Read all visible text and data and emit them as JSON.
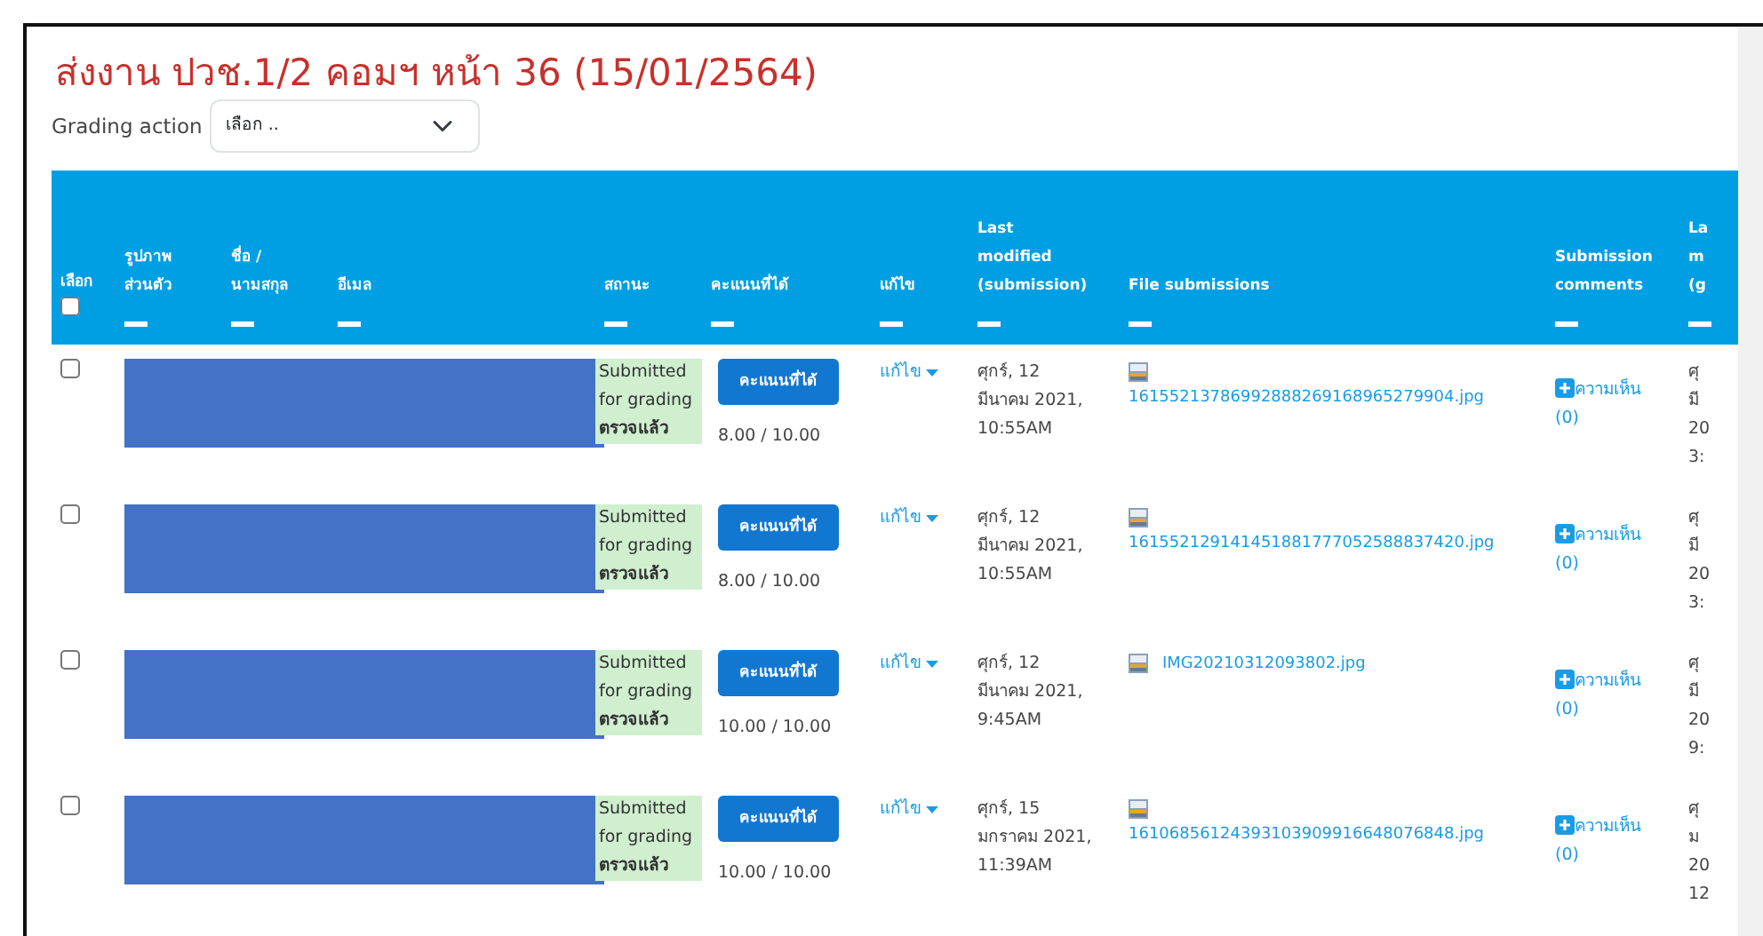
{
  "title": "ส่งงาน ปวช.1/2 คอมฯ หน้า 36 (15/01/2564)",
  "grading_action": {
    "label": "Grading action",
    "value": "เลือก .."
  },
  "table": {
    "select_all": {
      "label": "เลือก",
      "checked": false
    },
    "columns": [
      {
        "lines": [
          "รูปภาพ",
          "ส่วนตัว"
        ]
      },
      {
        "lines": [
          "ชื่อ /",
          "นามสกุล"
        ]
      },
      {
        "lines": [
          "อีเมล"
        ]
      },
      {
        "lines": [
          "สถานะ"
        ]
      },
      {
        "lines": [
          "คะแนนที่ได้"
        ]
      },
      {
        "lines": [
          "แก้ไข"
        ]
      },
      {
        "lines": [
          "Last",
          "modified",
          "(submission)"
        ]
      },
      {
        "lines": [
          "File submissions"
        ]
      },
      {
        "lines": [
          "Submission",
          "comments"
        ]
      },
      {
        "lines": [
          "La",
          "m",
          "(g"
        ]
      }
    ],
    "rows": [
      {
        "checked": false,
        "status": "Submitted for grading",
        "status_note": "ตรวจแล้ว",
        "grade_button": "คะแนนที่ได้",
        "grade": "8.00 / 10.00",
        "edit": "แก้ไข",
        "modified": [
          "ศุกร์, 12",
          "มีนาคม 2021,",
          "10:55AM"
        ],
        "file": "16155213786992888269168965279904.jpg",
        "comment_link": "ความเห็น",
        "comment_count": "(0)",
        "column_10": [
          "ศุ",
          "มี",
          "20",
          "3:"
        ]
      },
      {
        "checked": false,
        "status": "Submitted for grading",
        "status_note": "ตรวจแล้ว",
        "grade_button": "คะแนนที่ได้",
        "grade": "8.00 / 10.00",
        "edit": "แก้ไข",
        "modified": [
          "ศุกร์, 12",
          "มีนาคม 2021,",
          "10:55AM"
        ],
        "file": "161552129141451881777052588837420.jpg",
        "comment_link": "ความเห็น",
        "comment_count": "(0)",
        "column_10": [
          "ศุ",
          "มี",
          "20",
          "3:"
        ]
      },
      {
        "checked": false,
        "status": "Submitted for grading",
        "status_note": "ตรวจแล้ว",
        "grade_button": "คะแนนที่ได้",
        "grade": "10.00 / 10.00",
        "edit": "แก้ไข",
        "modified": [
          "ศุกร์, 12",
          "มีนาคม 2021,",
          "9:45AM"
        ],
        "file": "IMG20210312093802.jpg",
        "comment_link": "ความเห็น",
        "comment_count": "(0)",
        "column_10": [
          "ศุ",
          "มี",
          "20",
          "9:"
        ]
      },
      {
        "checked": false,
        "status": "Submitted for grading",
        "status_note": "ตรวจแล้ว",
        "grade_button": "คะแนนที่ได้",
        "grade": "10.00 / 10.00",
        "edit": "แก้ไข",
        "modified": [
          "ศุกร์, 15",
          "มกราคม 2021,",
          "11:39AM"
        ],
        "file": "16106856124393103909916648076848.jpg",
        "comment_link": "ความเห็น",
        "comment_count": "(0)",
        "column_10": [
          "ศุ",
          "ม",
          "20",
          "12"
        ]
      }
    ]
  }
}
